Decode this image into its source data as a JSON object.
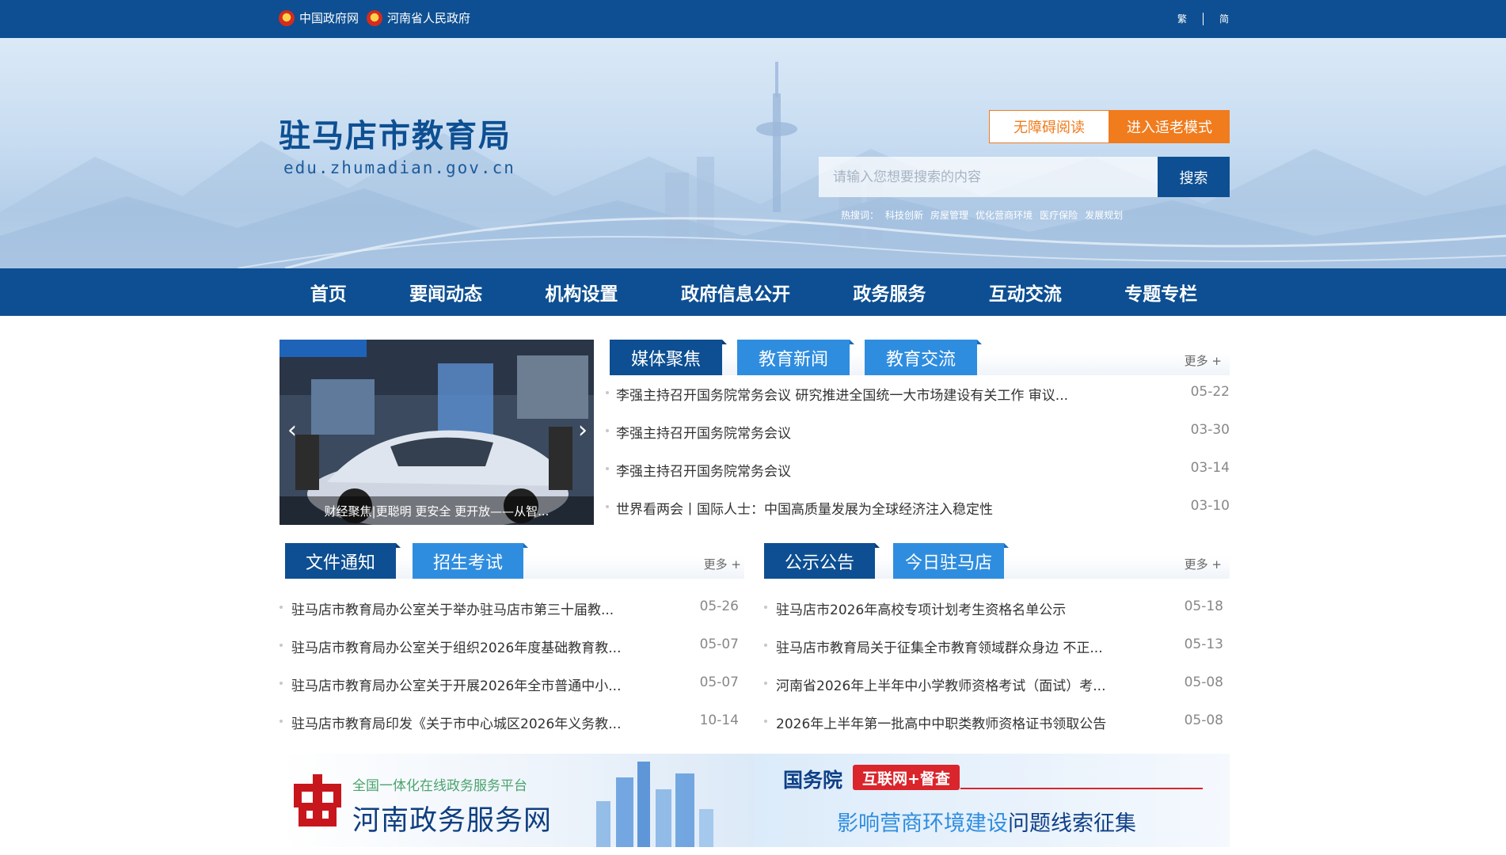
{
  "topbar": {
    "links": [
      "中国政府网",
      "河南省人民政府"
    ],
    "lang_traditional": "繁",
    "lang_simplified": "简"
  },
  "header": {
    "title": "驻马店市教育局",
    "domain": "edu.zhumadian.gov.cn",
    "accessibility_label": "无障碍阅读",
    "elder_mode_label": "进入适老模式",
    "search_placeholder": "请输入您想要搜索的内容",
    "search_button": "搜索",
    "hot_label": "热搜词：",
    "hot_words": [
      "科技创新",
      "房屋管理",
      "优化营商环境",
      "医疗保险",
      "发展规划"
    ]
  },
  "nav": {
    "items": [
      "首页",
      "要闻动态",
      "机构设置",
      "政府信息公开",
      "政务服务",
      "互动交流",
      "专题专栏"
    ]
  },
  "slider": {
    "caption": "财经聚焦|更聪明 更安全 更开放——从智...",
    "prev": "‹",
    "next": "›"
  },
  "news_panel": {
    "tabs": [
      "媒体聚焦",
      "教育新闻",
      "教育交流"
    ],
    "more": "更多 +",
    "items": [
      {
        "title": "李强主持召开国务院常务会议 研究推进全国统一大市场建设有关工作 审议...",
        "date": "05-22"
      },
      {
        "title": "李强主持召开国务院常务会议",
        "date": "03-30"
      },
      {
        "title": "李强主持召开国务院常务会议",
        "date": "03-14"
      },
      {
        "title": "世界看两会丨国际人士：中国高质量发展为全球经济注入稳定性",
        "date": "03-10"
      }
    ]
  },
  "docs_panel": {
    "tabs": [
      "文件通知",
      "招生考试"
    ],
    "more": "更多 +",
    "items": [
      {
        "title": "驻马店市教育局办公室关于举办驻马店市第三十届教...",
        "date": "05-26"
      },
      {
        "title": "驻马店市教育局办公室关于组织2026年度基础教育教...",
        "date": "05-07"
      },
      {
        "title": "驻马店市教育局办公室关于开展2026年全市普通中小...",
        "date": "05-07"
      },
      {
        "title": "驻马店市教育局印发《关于市中心城区2026年义务教...",
        "date": "10-14"
      }
    ]
  },
  "notice_panel": {
    "tabs": [
      "公示公告",
      "今日驻马店"
    ],
    "more": "更多 +",
    "items": [
      {
        "title": "驻马店市2026年高校专项计划考生资格名单公示",
        "date": "05-18"
      },
      {
        "title": "驻马店市教育局关于征集全市教育领域群众身边 不正...",
        "date": "05-13"
      },
      {
        "title": "河南省2026年上半年中小学教师资格考试（面试）考...",
        "date": "05-08"
      },
      {
        "title": "2026年上半年第一批高中中职类教师资格证书领取公告",
        "date": "05-08"
      }
    ]
  },
  "bottom_banner": {
    "left_small": "全国一体化在线政务服务平台",
    "left_big": "河南政务服务网",
    "right_title": "国务院",
    "right_tag": "互联网+督查",
    "right_sub_em": "影响营商环境建设",
    "right_sub": "问题线索征集"
  },
  "colors": {
    "primary": "#0d4f92",
    "tab_inactive": "#2f8ddf",
    "accent_orange": "#f07c1e",
    "red": "#d9252b"
  }
}
